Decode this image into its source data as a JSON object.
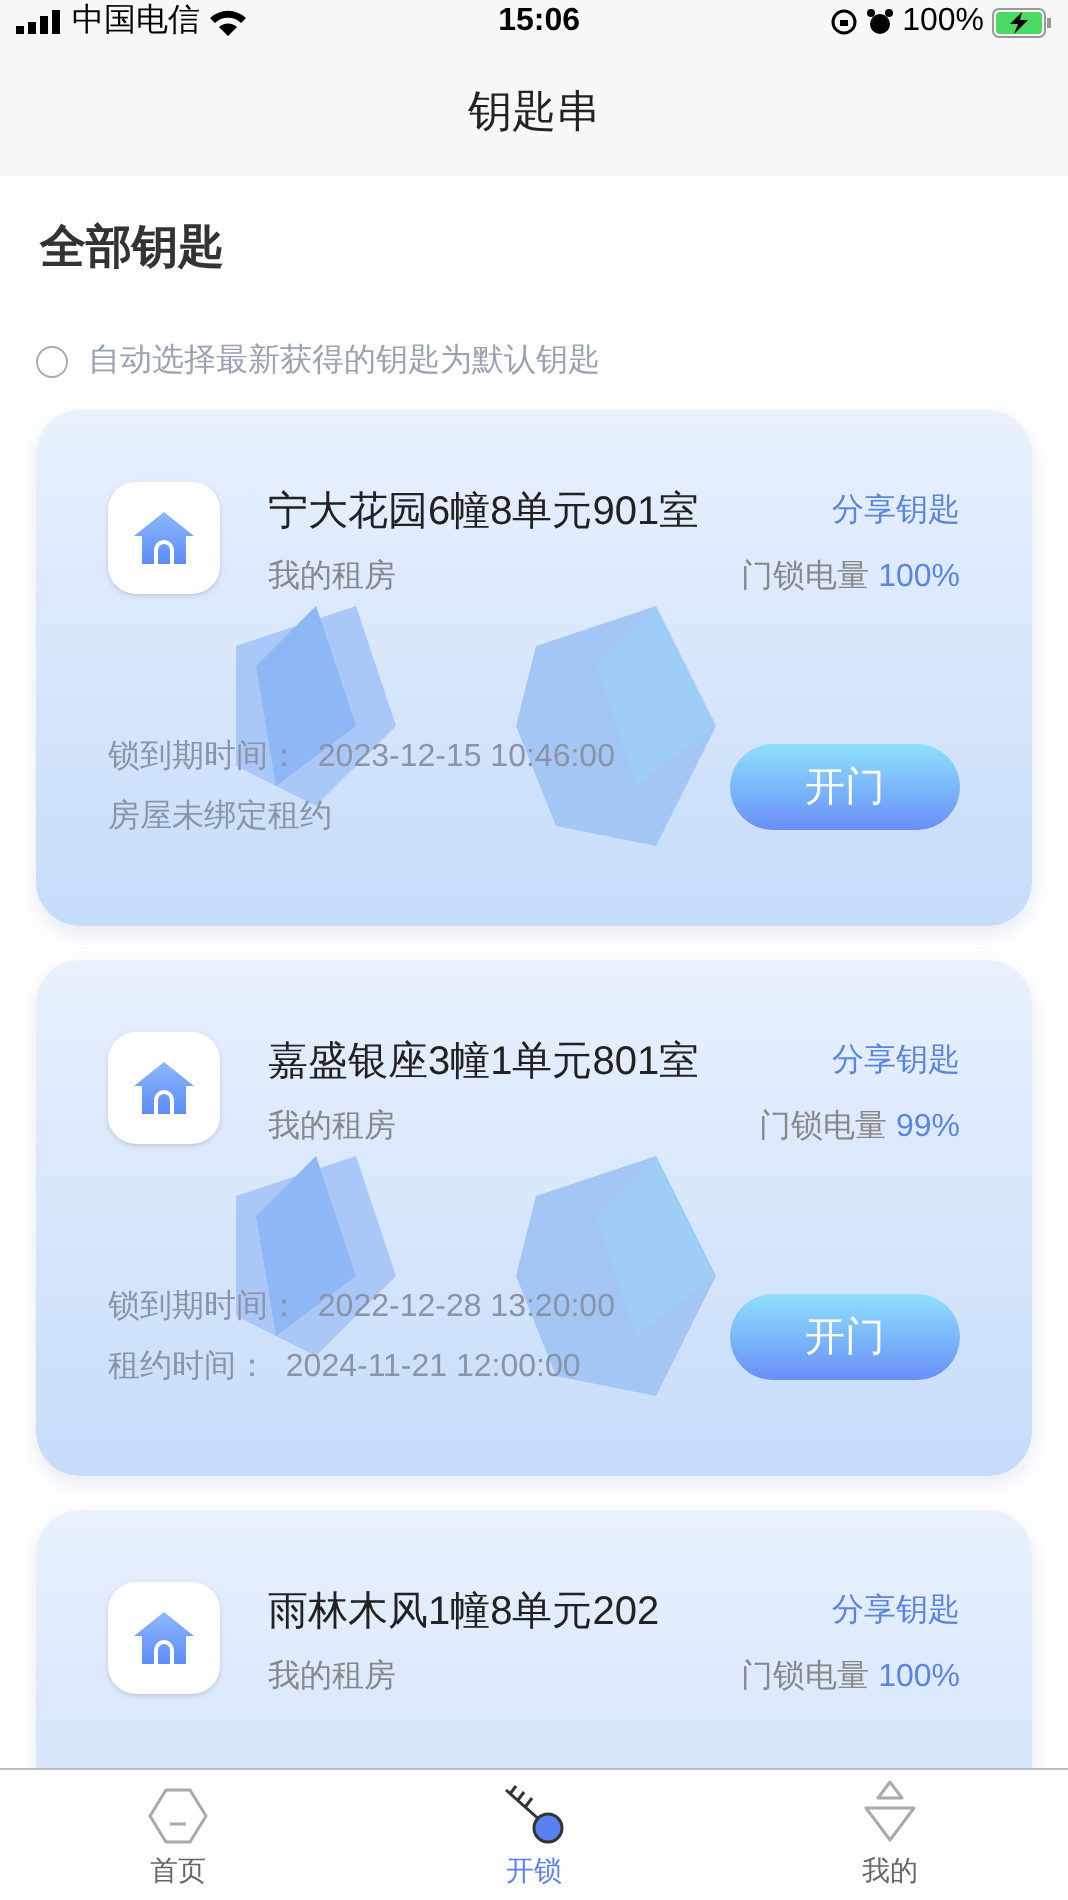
{
  "status_bar": {
    "carrier": "中国电信",
    "time": "15:06",
    "battery": "100%"
  },
  "nav": {
    "title": "钥匙串"
  },
  "section_title": "全部钥匙",
  "auto_select": {
    "label": "自动选择最新获得的钥匙为默认钥匙",
    "checked": false
  },
  "keys": [
    {
      "name": "宁大花园6幢8单元901室",
      "subtitle": "我的租房",
      "share": "分享钥匙",
      "battery_label": "门锁电量",
      "battery": "100%",
      "info": [
        "锁到期时间：  2023-12-15 10:46:00",
        "房屋未绑定租约"
      ],
      "button": "开门"
    },
    {
      "name": "嘉盛银座3幢1单元801室",
      "subtitle": "我的租房",
      "share": "分享钥匙",
      "battery_label": "门锁电量",
      "battery": "99%",
      "info": [
        "锁到期时间：  2022-12-28 13:20:00",
        "租约时间：  2024-11-21 12:00:00"
      ],
      "button": "开门"
    },
    {
      "name": "雨林木风1幢8单元202",
      "subtitle": "我的租房",
      "share": "分享钥匙",
      "battery_label": "门锁电量",
      "battery": "100%"
    }
  ],
  "tabs": [
    {
      "label": "首页",
      "kind": "home",
      "selected": false
    },
    {
      "label": "开锁",
      "kind": "key",
      "selected": true
    },
    {
      "label": "我的",
      "kind": "profile",
      "selected": false
    }
  ]
}
